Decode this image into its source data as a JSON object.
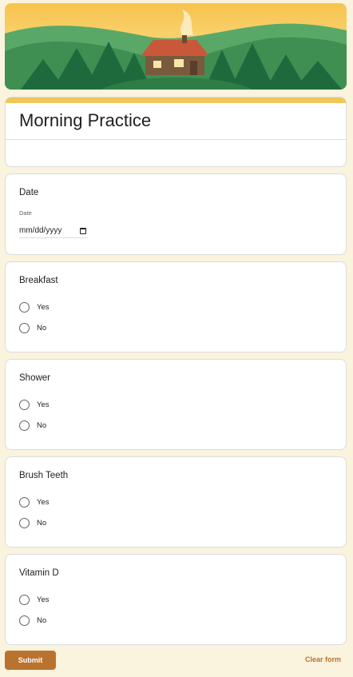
{
  "form": {
    "title": "Morning Practice"
  },
  "date_question": {
    "title": "Date",
    "field_label": "Date",
    "placeholder": "mm/dd/yyyy"
  },
  "questions": [
    {
      "title": "Breakfast",
      "options": [
        "Yes",
        "No"
      ]
    },
    {
      "title": "Shower",
      "options": [
        "Yes",
        "No"
      ]
    },
    {
      "title": "Brush Teeth",
      "options": [
        "Yes",
        "No"
      ]
    },
    {
      "title": "Vitamin D",
      "options": [
        "Yes",
        "No"
      ]
    }
  ],
  "actions": {
    "submit": "Submit",
    "clear": "Clear form"
  },
  "colors": {
    "background": "#faf3dd",
    "accent": "#eec75c",
    "button": "#b9732e"
  },
  "header_image": "cabin-in-forest-illustration"
}
